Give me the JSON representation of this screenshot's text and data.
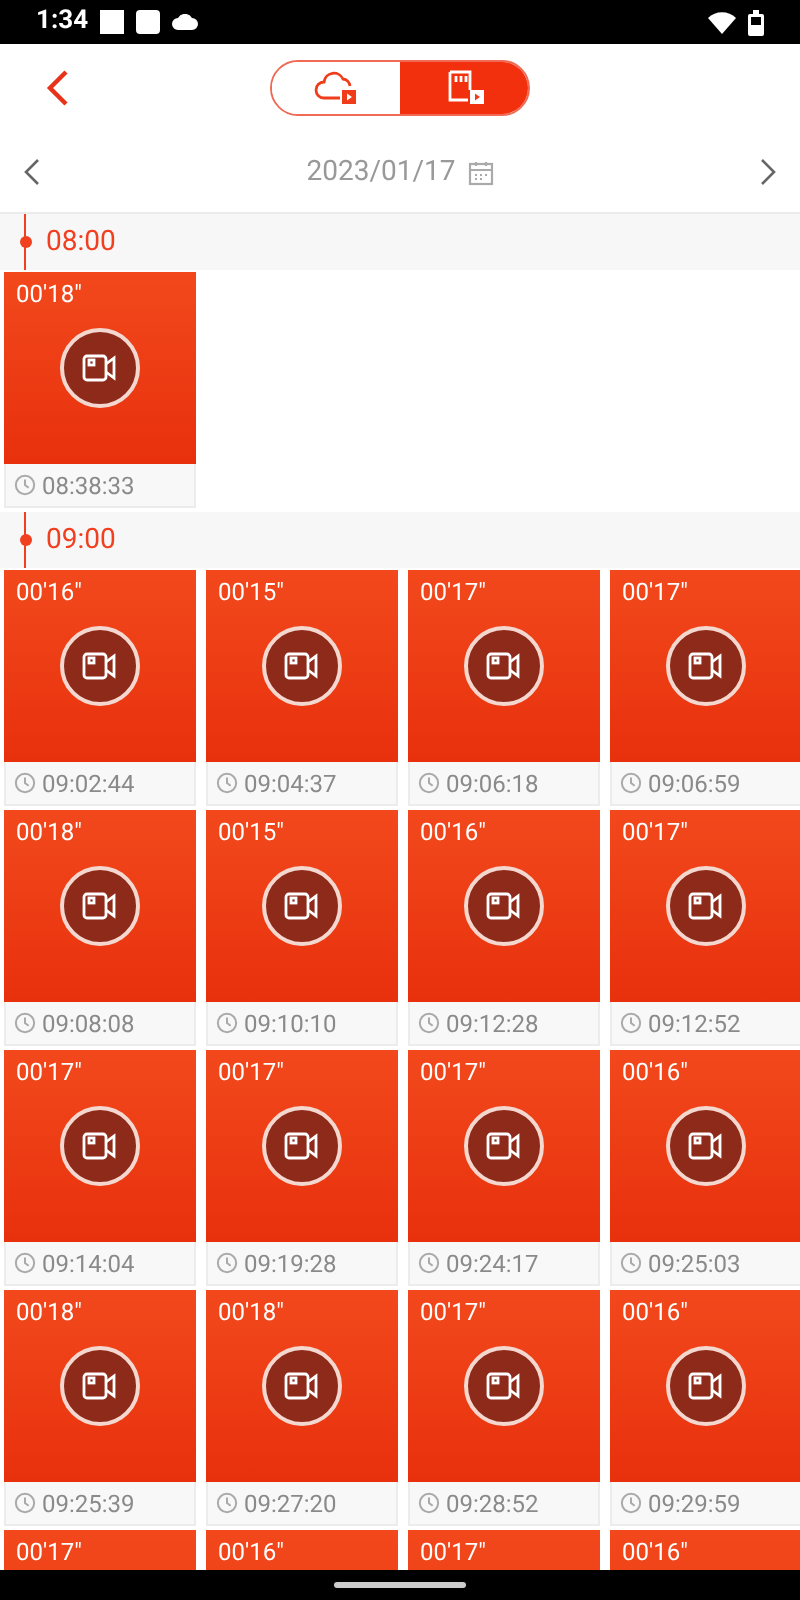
{
  "status_bar": {
    "time": "1:34"
  },
  "source_tabs": [
    {
      "kind": "cloud",
      "selected": false
    },
    {
      "kind": "sdcard",
      "selected": true
    }
  ],
  "date_nav": {
    "date": "2023/01/17"
  },
  "sections": [
    {
      "time": "08:00",
      "clips": [
        {
          "duration": "00'18\"",
          "time": "08:38:33"
        }
      ]
    },
    {
      "time": "09:00",
      "clips": [
        {
          "duration": "00'16\"",
          "time": "09:02:44"
        },
        {
          "duration": "00'15\"",
          "time": "09:04:37"
        },
        {
          "duration": "00'17\"",
          "time": "09:06:18"
        },
        {
          "duration": "00'17\"",
          "time": "09:06:59"
        },
        {
          "duration": "00'18\"",
          "time": "09:08:08"
        },
        {
          "duration": "00'15\"",
          "time": "09:10:10"
        },
        {
          "duration": "00'16\"",
          "time": "09:12:28"
        },
        {
          "duration": "00'17\"",
          "time": "09:12:52"
        },
        {
          "duration": "00'17\"",
          "time": "09:14:04"
        },
        {
          "duration": "00'17\"",
          "time": "09:19:28"
        },
        {
          "duration": "00'17\"",
          "time": "09:24:17"
        },
        {
          "duration": "00'16\"",
          "time": "09:25:03"
        },
        {
          "duration": "00'18\"",
          "time": "09:25:39"
        },
        {
          "duration": "00'18\"",
          "time": "09:27:20"
        },
        {
          "duration": "00'17\"",
          "time": "09:28:52"
        },
        {
          "duration": "00'16\"",
          "time": "09:29:59"
        },
        {
          "duration": "00'17\""
        },
        {
          "duration": "00'16\""
        },
        {
          "duration": "00'17\""
        },
        {
          "duration": "00'16\""
        }
      ]
    }
  ]
}
